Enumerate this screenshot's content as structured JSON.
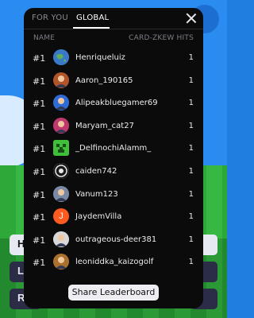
{
  "tabs": {
    "for_you": "FOR YOU",
    "global": "GLOBAL",
    "active": "GLOBAL"
  },
  "columns": {
    "name": "NAME",
    "hits": "CARD-ZKEW HITS"
  },
  "rows": [
    {
      "rank": "#1",
      "username": "Henriqueluiz",
      "hits": "1",
      "avatar": "earth-icon",
      "avatar_color": "#3a78c8"
    },
    {
      "rank": "#1",
      "username": "Aaron_190165",
      "hits": "1",
      "avatar": "character-icon",
      "avatar_color": "#b0542a"
    },
    {
      "rank": "#1",
      "username": "Alipeakbluegamer69",
      "hits": "1",
      "avatar": "character-icon",
      "avatar_color": "#2f6bd6"
    },
    {
      "rank": "#1",
      "username": "Maryam_cat27",
      "hits": "1",
      "avatar": "character-icon",
      "avatar_color": "#c0396e"
    },
    {
      "rank": "#1",
      "username": "_DelfinochiAlamm_",
      "hits": "1",
      "avatar": "creeper-icon",
      "avatar_color": "#3fbf3a"
    },
    {
      "rank": "#1",
      "username": "caiden742",
      "hits": "1",
      "avatar": "pattern-icon",
      "avatar_color": "#e8e8e8"
    },
    {
      "rank": "#1",
      "username": "Vanum123",
      "hits": "1",
      "avatar": "character-icon",
      "avatar_color": "#7a8aa6"
    },
    {
      "rank": "#1",
      "username": "JaydemVilla",
      "hits": "1",
      "avatar": "letter-j-icon",
      "avatar_color": "#ff5a1f",
      "avatar_letter": "J"
    },
    {
      "rank": "#1",
      "username": "outrageous-deer381",
      "hits": "1",
      "avatar": "character-icon",
      "avatar_color": "#d8d8d8"
    },
    {
      "rank": "#1",
      "username": "leoniddka_kaizogolf",
      "hits": "1",
      "avatar": "character-icon",
      "avatar_color": "#a9702e"
    }
  ],
  "share_button": "Share Leaderboard",
  "background_buttons": [
    {
      "label": "H",
      "style": "light"
    },
    {
      "label": "L",
      "style": "dark"
    },
    {
      "label": "R",
      "style": "dark"
    }
  ]
}
